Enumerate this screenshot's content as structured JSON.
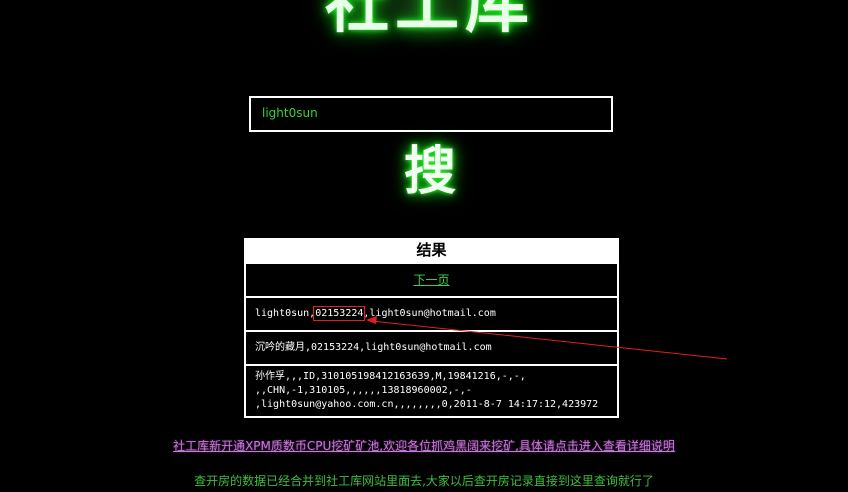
{
  "logo": {
    "text": "社工库"
  },
  "search": {
    "value": "light0sun",
    "button_label": "搜"
  },
  "results": {
    "title": "结果",
    "next_page": "下一页",
    "row1": {
      "prefix": "light0sun,",
      "highlight": "02153224",
      "suffix": ",light0sun@hotmail.com"
    },
    "row2": "沉吟的藏月,02153224,light0sun@hotmail.com",
    "row3": {
      "line1": "孙作孚,,,ID,310105198412163639,M,19841216,-,-,",
      "line2": ",,CHN,-1,310105,,,,,,13818960002,-,-",
      "line3": ",light0sun@yahoo.com.cn,,,,,,,,0,2011-8-7 14:17:12,423972"
    }
  },
  "notices": {
    "mining": "社工库新开通XPM质数币CPU挖矿矿池,欢迎各位抓鸡黑阔来挖矿,具体请点击进入查看详细说明",
    "merged": "查开房的数据已经合并到社工库网站里面去,大家以后查开房记录直接到这里查询就行了"
  },
  "colors": {
    "accent_green": "#3cd33c",
    "highlight_red": "#e02020",
    "notice_purple": "#c77bd7"
  }
}
